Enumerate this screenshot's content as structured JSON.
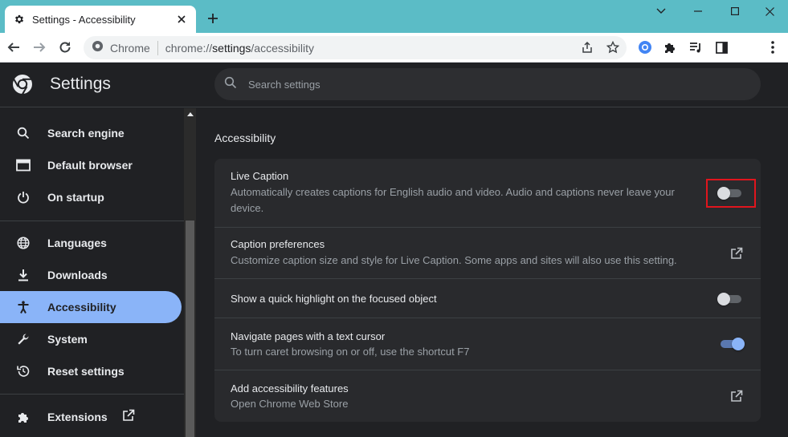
{
  "tab": {
    "title": "Settings - Accessibility"
  },
  "omnibox": {
    "site": "Chrome",
    "url_scheme": "chrome://",
    "url_host": "settings",
    "url_path": "/accessibility"
  },
  "header": {
    "title": "Settings",
    "search_placeholder": "Search settings"
  },
  "sidebar": {
    "items": [
      {
        "label": "Search engine",
        "icon": "search-icon"
      },
      {
        "label": "Default browser",
        "icon": "browser-icon"
      },
      {
        "label": "On startup",
        "icon": "power-icon"
      },
      {
        "label": "Languages",
        "icon": "globe-icon"
      },
      {
        "label": "Downloads",
        "icon": "download-icon"
      },
      {
        "label": "Accessibility",
        "icon": "accessibility-icon",
        "active": true
      },
      {
        "label": "System",
        "icon": "wrench-icon"
      },
      {
        "label": "Reset settings",
        "icon": "reset-icon"
      },
      {
        "label": "Extensions",
        "icon": "puzzle-icon"
      }
    ]
  },
  "main": {
    "section_title": "Accessibility",
    "rows": [
      {
        "title": "Live Caption",
        "desc_line1": "Automatically creates captions for English audio and video. Audio and captions never leave your",
        "desc_line2": "device.",
        "control": "toggle",
        "checked": false
      },
      {
        "title": "Caption preferences",
        "desc": "Customize caption size and style for Live Caption. Some apps and sites will also use this setting.",
        "control": "external-link"
      },
      {
        "title": "Show a quick highlight on the focused object",
        "control": "toggle",
        "checked": false
      },
      {
        "title": "Navigate pages with a text cursor",
        "desc": "To turn caret browsing on or off, use the shortcut F7",
        "control": "toggle",
        "checked": true
      },
      {
        "title": "Add accessibility features",
        "desc": "Open Chrome Web Store",
        "control": "external-link"
      }
    ]
  },
  "colors": {
    "accent": "#8ab4f8",
    "frame": "#5bbcc6",
    "highlight": "#e0151d",
    "background": "#202124"
  }
}
